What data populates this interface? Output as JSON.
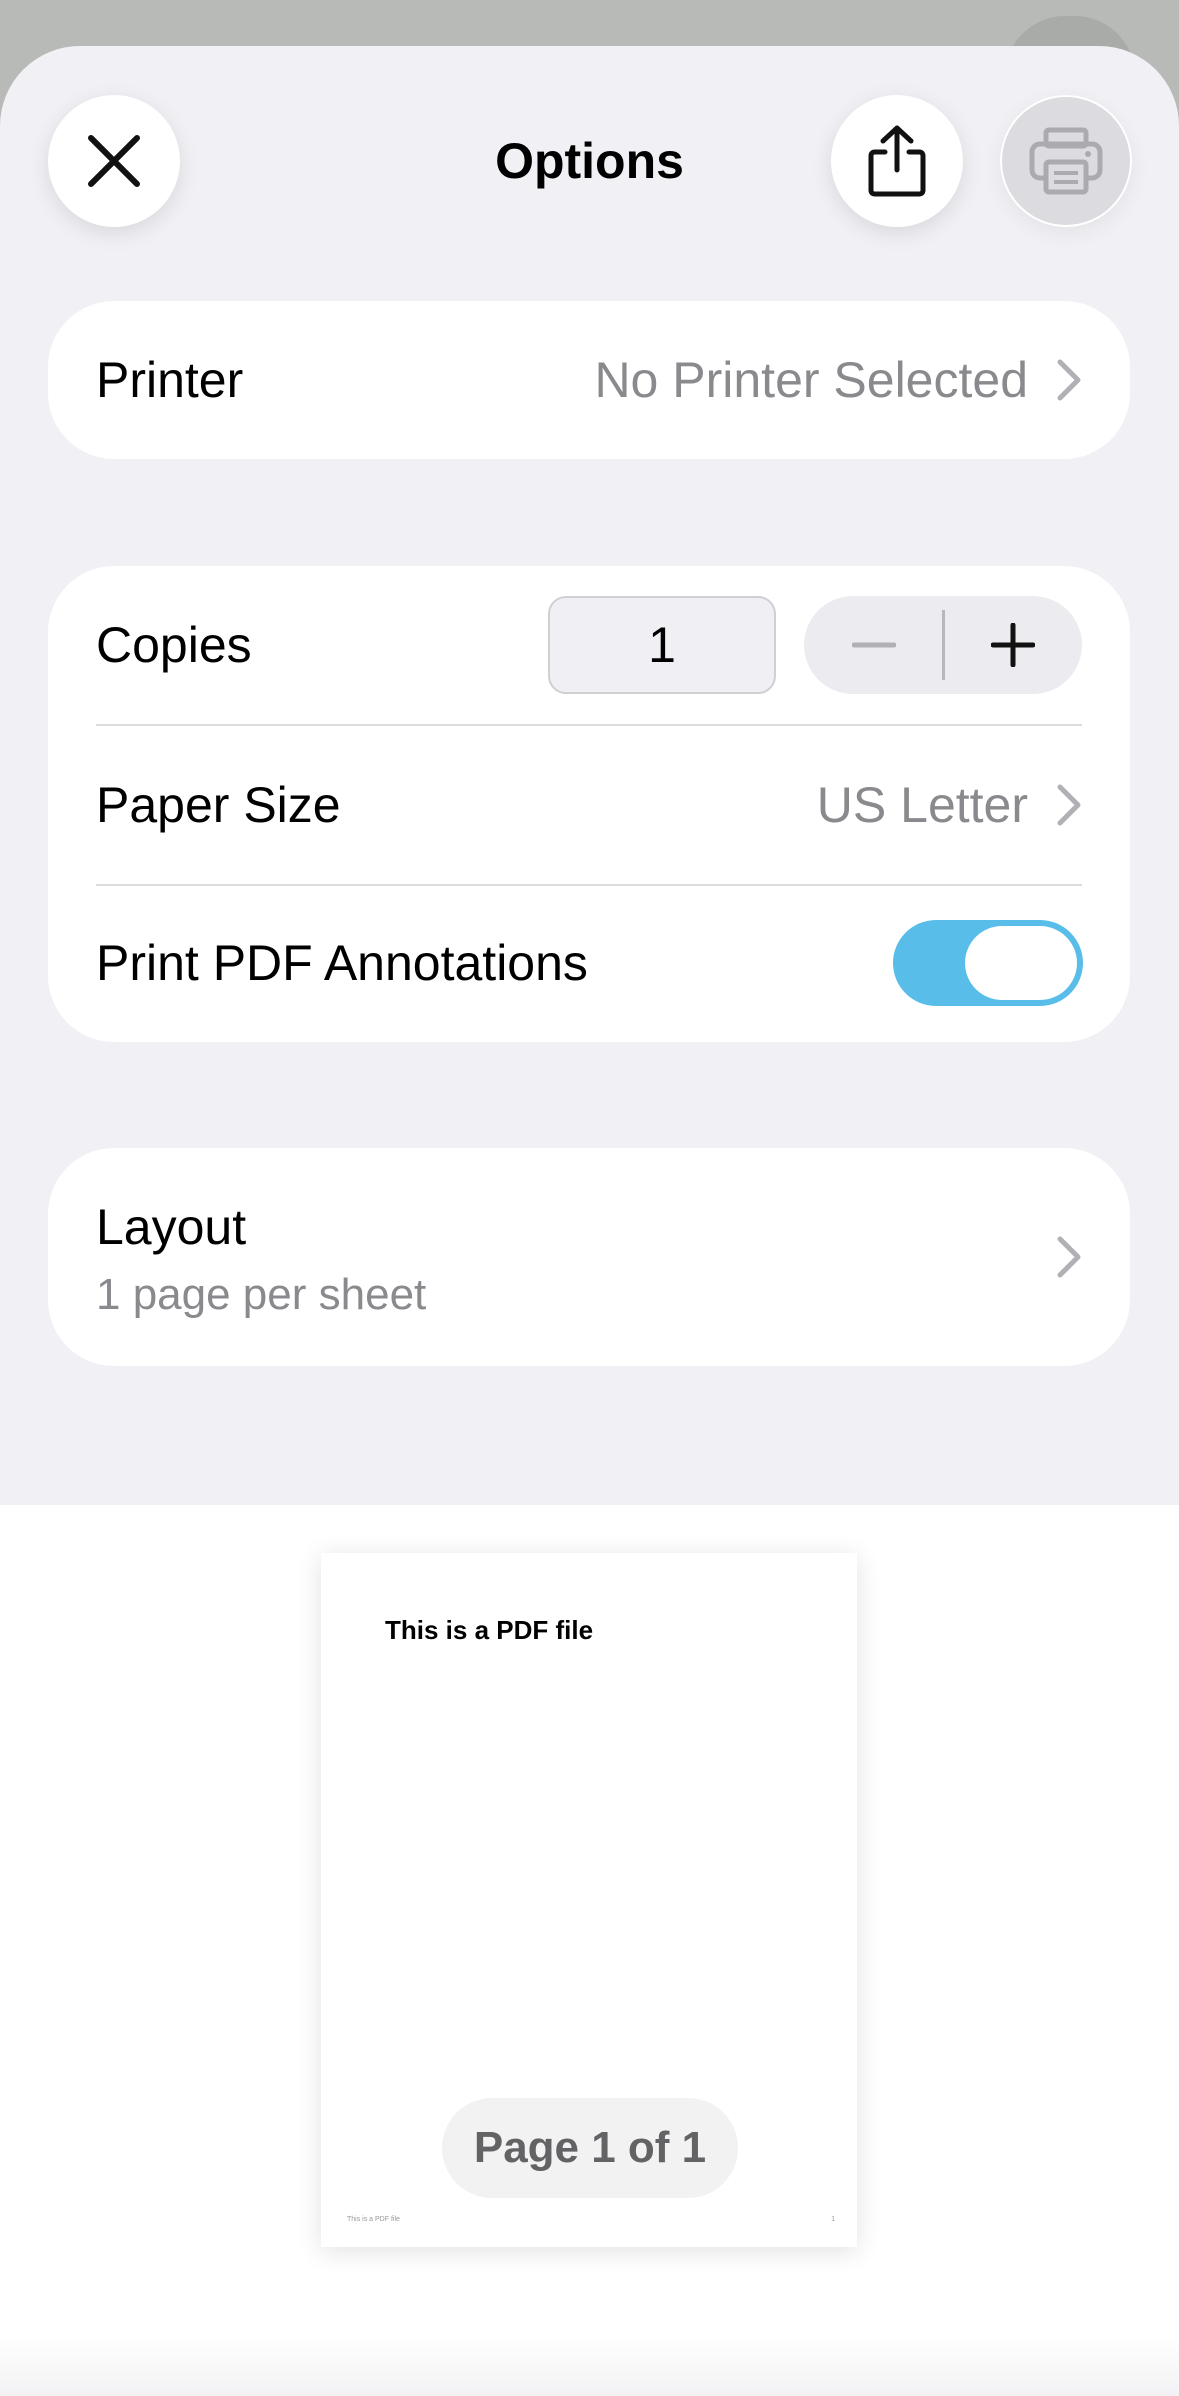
{
  "header": {
    "title": "Options"
  },
  "printer": {
    "label": "Printer",
    "value": "No Printer Selected"
  },
  "copies": {
    "label": "Copies",
    "value": "1"
  },
  "paper_size": {
    "label": "Paper Size",
    "value": "US Letter"
  },
  "annotations": {
    "label": "Print PDF Annotations",
    "enabled": true,
    "accent_color": "#58bde9"
  },
  "layout": {
    "label": "Layout",
    "value": "1 page per sheet"
  },
  "preview": {
    "heading": "This is a PDF file",
    "footer_text": "This is a PDF file",
    "footer_page_number": "1",
    "page_indicator": "Page 1 of 1"
  },
  "icons": [
    "close-icon",
    "share-icon",
    "printer-icon",
    "chevron-right-icon",
    "minus-icon",
    "plus-icon"
  ]
}
